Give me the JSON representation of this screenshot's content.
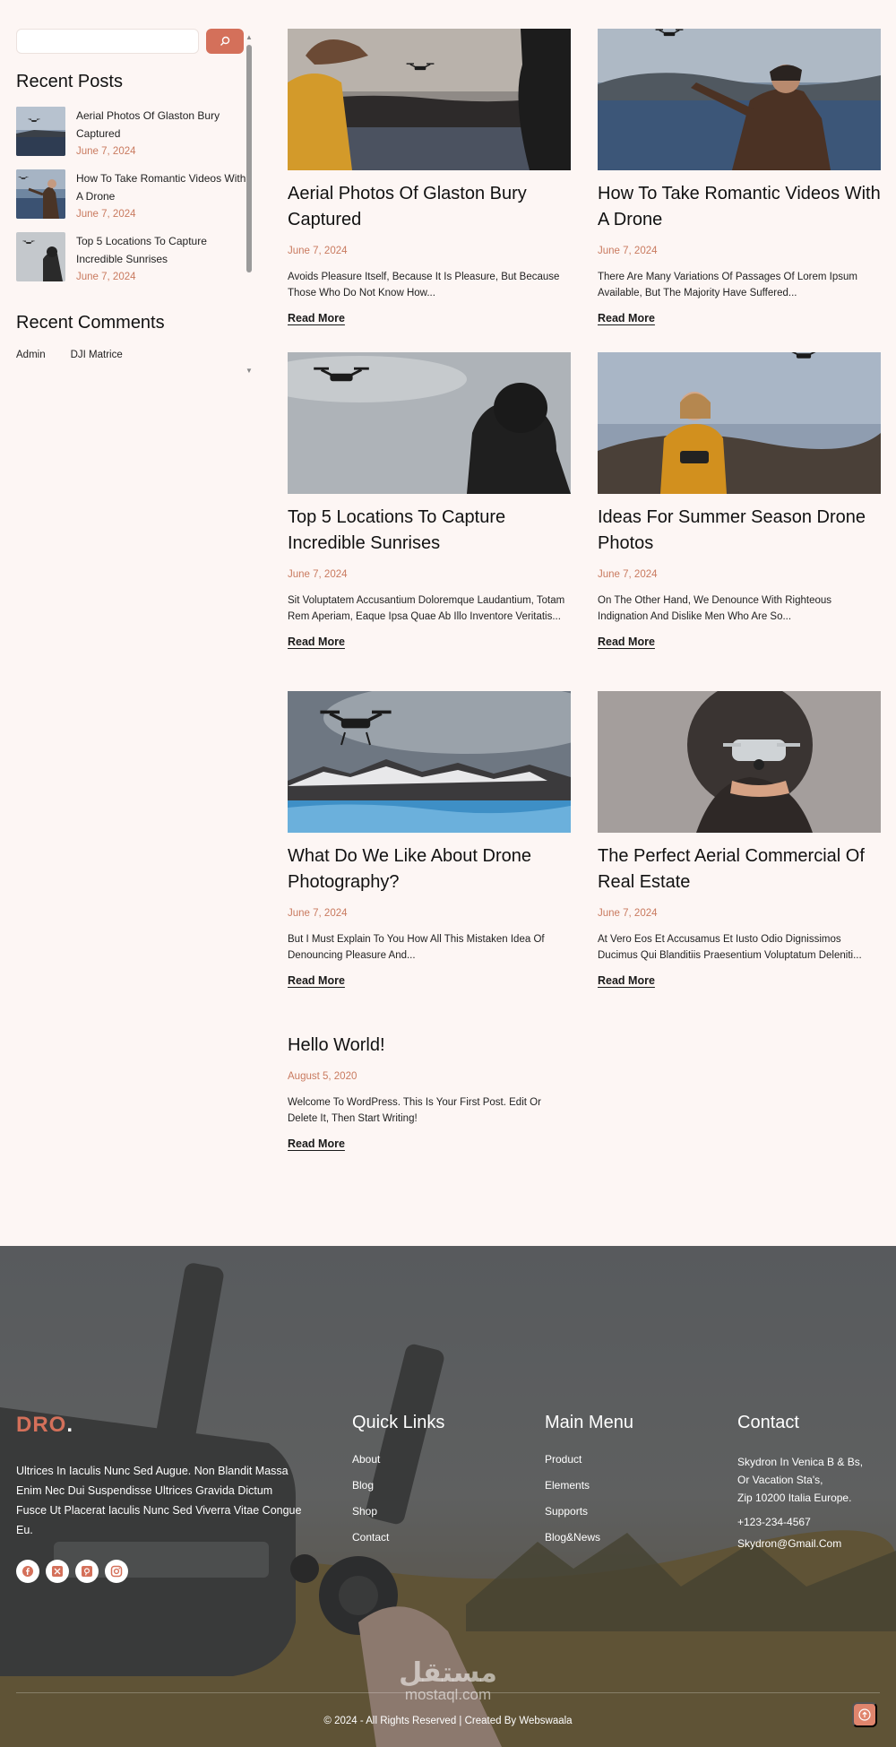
{
  "search": {
    "placeholder": ""
  },
  "sidebar": {
    "recent_posts_title": "Recent Posts",
    "recent_posts": [
      {
        "title": "Aerial Photos Of Glaston Bury Captured",
        "date": "June 7, 2024"
      },
      {
        "title": "How To Take Romantic Videos With A Drone",
        "date": "June 7, 2024"
      },
      {
        "title": "Top 5 Locations To Capture Incredible Sunrises",
        "date": "June 7, 2024"
      }
    ],
    "recent_comments_title": "Recent Comments",
    "recent_comments": {
      "author": "Admin",
      "post": "DJI Matrice"
    }
  },
  "posts": [
    {
      "title": "Aerial Photos Of Glaston Bury Captured",
      "date": "June 7, 2024",
      "excerpt": "Avoids Pleasure Itself, Because It Is Pleasure, But Because Those Who Do Not Know How...",
      "read_more": "Read More"
    },
    {
      "title": "How To Take Romantic Videos With A Drone",
      "date": "June 7, 2024",
      "excerpt": "There Are Many Variations Of Passages Of Lorem Ipsum Available, But The Majority Have Suffered...",
      "read_more": "Read More"
    },
    {
      "title": "Top 5 Locations To Capture Incredible Sunrises",
      "date": "June 7, 2024",
      "excerpt": "Sit Voluptatem Accusantium Doloremque Laudantium, Totam Rem Aperiam, Eaque Ipsa Quae Ab Illo Inventore Veritatis...",
      "read_more": "Read More"
    },
    {
      "title": "Ideas For Summer Season Drone Photos",
      "date": "June 7, 2024",
      "excerpt": "On The Other Hand, We Denounce With Righteous Indignation And Dislike Men Who Are So...",
      "read_more": "Read More"
    },
    {
      "title": "What Do We Like About Drone Photography?",
      "date": "June 7, 2024",
      "excerpt": "But I Must Explain To You How All This Mistaken Idea Of Denouncing Pleasure And...",
      "read_more": "Read More"
    },
    {
      "title": "The Perfect Aerial Commercial Of Real Estate",
      "date": "June 7, 2024",
      "excerpt": "At Vero Eos Et Accusamus Et Iusto Odio Dignissimos Ducimus Qui Blanditiis Praesentium Voluptatum Deleniti...",
      "read_more": "Read More"
    },
    {
      "title": "Hello World!",
      "date": "August 5, 2020",
      "excerpt": "Welcome To WordPress. This Is Your First Post. Edit Or Delete It, Then Start Writing!",
      "read_more": "Read More"
    }
  ],
  "footer": {
    "brand": "DRO",
    "brand_dot": ".",
    "description": "Ultrices In Iaculis Nunc Sed Augue. Non Blandit Massa Enim Nec Dui Suspendisse Ultrices Gravida Dictum Fusce Ut Placerat Iaculis Nunc Sed Viverra Vitae Congue Eu.",
    "socials": [
      "facebook-icon",
      "x-icon",
      "pinterest-icon",
      "instagram-icon"
    ],
    "quick_links": {
      "title": "Quick Links",
      "items": [
        "About",
        "Blog",
        "Shop",
        "Contact"
      ]
    },
    "main_menu": {
      "title": "Main Menu",
      "items": [
        "Product",
        "Elements",
        "Supports",
        "Blog&News"
      ]
    },
    "contact": {
      "title": "Contact",
      "address_1": "Skydron In Venica B & Bs,",
      "address_2": "Or Vacation Sta's,",
      "address_3": "Zip 10200 Italia Europe.",
      "phone": "+123-234-4567",
      "email": "Skydron@Gmail.Com"
    },
    "copyright": "© 2024 - All Rights Reserved | Created By Webswaala",
    "watermark_ar": "مستقل",
    "watermark_en": "mostaql.com"
  },
  "colors": {
    "accent": "#d4705a",
    "date": "#c97a5f",
    "background": "#fdf6f4"
  }
}
